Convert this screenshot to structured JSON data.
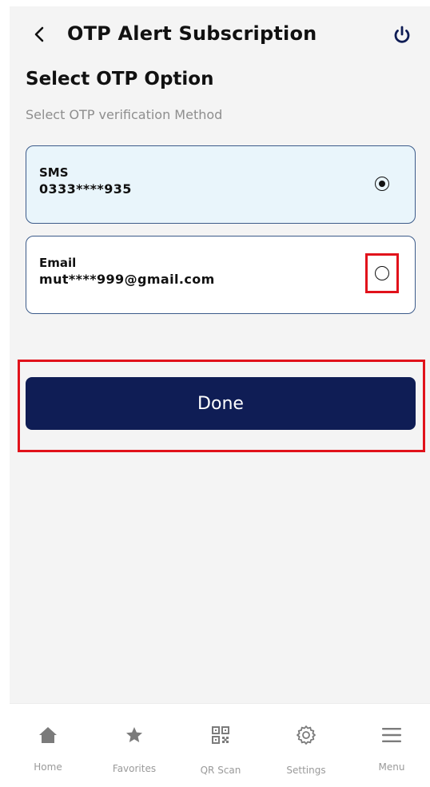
{
  "header": {
    "title": "OTP Alert Subscription",
    "back_icon": "chevron-left-icon",
    "power_icon": "power-icon",
    "accent_color": "#0f1d55"
  },
  "main": {
    "title": "Select OTP Option",
    "subtitle": "Select OTP verification Method",
    "options": [
      {
        "name": "SMS",
        "value": "0333****935",
        "selected": true
      },
      {
        "name": "Email",
        "value": "mut****999@gmail.com",
        "selected": false
      }
    ],
    "done_label": "Done",
    "highlight_color": "#e1121b"
  },
  "bottom_nav": {
    "items": [
      {
        "label": "Home",
        "icon": "home-icon"
      },
      {
        "label": "Favorites",
        "icon": "star-icon"
      },
      {
        "label": "QR Scan",
        "icon": "qr-code-icon"
      },
      {
        "label": "Settings",
        "icon": "gear-icon"
      },
      {
        "label": "Menu",
        "icon": "hamburger-menu-icon"
      }
    ]
  }
}
